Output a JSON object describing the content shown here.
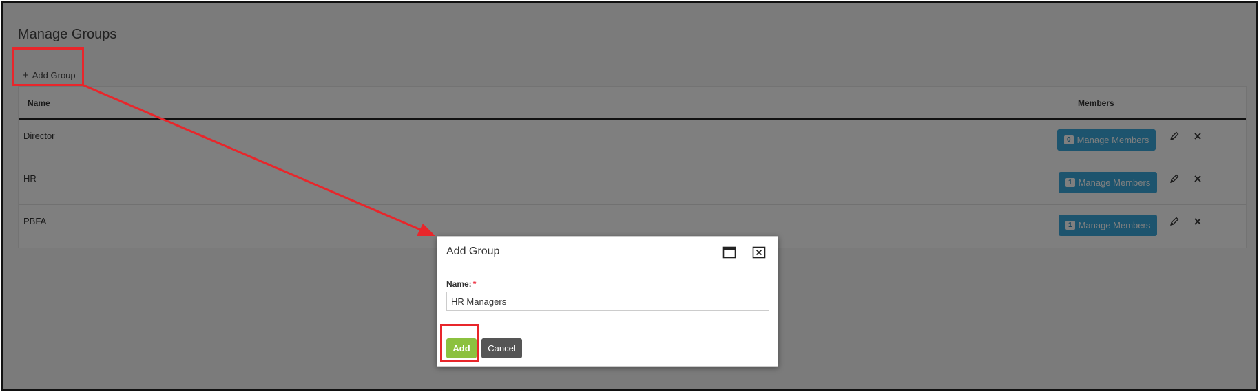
{
  "page": {
    "title": "Manage Groups",
    "add_group_label": "Add Group"
  },
  "table": {
    "headers": {
      "name": "Name",
      "members": "Members"
    },
    "rows": [
      {
        "name": "Director",
        "member_count": "0",
        "manage_label": "Manage Members"
      },
      {
        "name": "HR",
        "member_count": "1",
        "manage_label": "Manage Members"
      },
      {
        "name": "PBFA",
        "member_count": "1",
        "manage_label": "Manage Members"
      }
    ]
  },
  "dialog": {
    "title": "Add Group",
    "name_label": "Name:",
    "required_mark": "*",
    "name_value": "HR Managers",
    "add_label": "Add",
    "cancel_label": "Cancel"
  },
  "icons": {
    "row_edit": "pencil-icon",
    "row_delete": "close-icon",
    "dialog_maximize": "window-maximize-icon",
    "dialog_close": "window-close-icon"
  },
  "colors": {
    "manage_button": "#3aa9dc",
    "add_button": "#8cc13f",
    "cancel_button": "#555555",
    "annotation": "#e8262b"
  }
}
